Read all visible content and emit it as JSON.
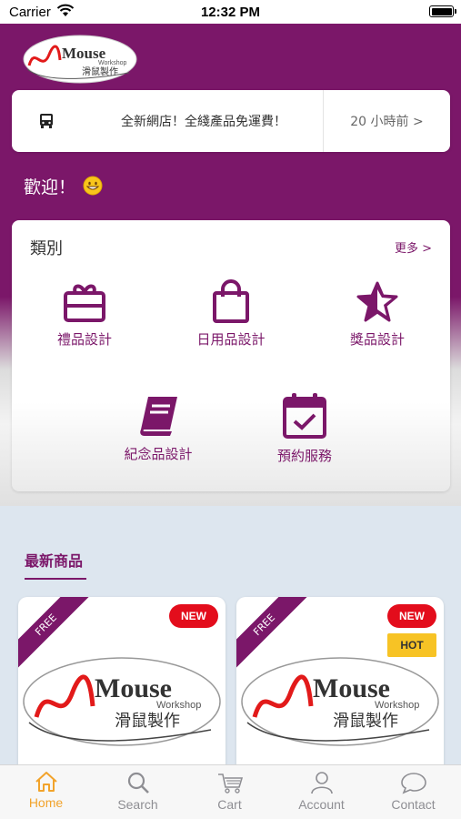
{
  "status_bar": {
    "carrier": "Carrier",
    "time": "12:32 PM"
  },
  "logo": {
    "brand": "Mouse",
    "sub": "Workshop",
    "chinese": "滑鼠製作"
  },
  "notice": {
    "icon": "bus-icon",
    "text": "全新網店！全綫產品免運費！",
    "time": "20 小時前 >"
  },
  "welcome": {
    "text": "歡迎！"
  },
  "categories": {
    "title": "類別",
    "more": "更多 >",
    "items": [
      {
        "label": "禮品設計",
        "icon": "gift-icon"
      },
      {
        "label": "日用品設計",
        "icon": "shopping-bag-icon"
      },
      {
        "label": "獎品設計",
        "icon": "star-icon"
      },
      {
        "label": "紀念品設計",
        "icon": "book-icon"
      },
      {
        "label": "預約服務",
        "icon": "calendar-check-icon"
      }
    ]
  },
  "new_products": {
    "title": "最新商品",
    "items": [
      {
        "ribbon": "FREE",
        "badge": "NEW"
      },
      {
        "ribbon": "FREE",
        "badge": "NEW",
        "badge2": "HOT"
      }
    ]
  },
  "tabbar": {
    "active": "Home",
    "tabs": [
      {
        "label": "Home",
        "icon": "home-icon"
      },
      {
        "label": "Search",
        "icon": "search-icon"
      },
      {
        "label": "Cart",
        "icon": "cart-icon"
      },
      {
        "label": "Account",
        "icon": "account-icon"
      },
      {
        "label": "Contact",
        "icon": "chat-icon"
      }
    ]
  },
  "colors": {
    "brand_purple": "#7b1769",
    "tab_active": "#f2a32b",
    "badge_red": "#e30d1c",
    "badge_yellow": "#f7c325"
  }
}
